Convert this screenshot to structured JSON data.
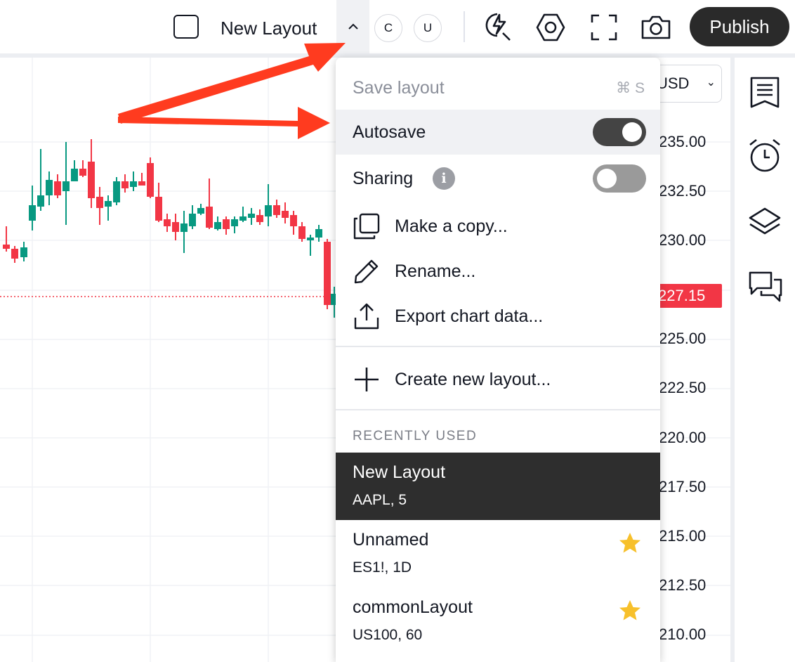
{
  "toolbar": {
    "layout_name": "New Layout",
    "c_label": "C",
    "u_label": "U",
    "publish_label": "Publish"
  },
  "price_scale": {
    "currency": "USD",
    "labels": [
      "235.00",
      "232.50",
      "230.00",
      "225.00",
      "222.50",
      "220.00",
      "217.50",
      "215.00",
      "212.50",
      "210.00"
    ],
    "current_price": "227.15"
  },
  "menu": {
    "save_layout": "Save layout",
    "save_shortcut": "⌘ S",
    "autosave": "Autosave",
    "autosave_on": true,
    "sharing": "Sharing",
    "sharing_info": "i",
    "sharing_on": false,
    "make_copy": "Make a copy...",
    "rename": "Rename...",
    "export": "Export chart data...",
    "create_new": "Create new layout...",
    "recently_used_title": "RECENTLY USED",
    "recent": [
      {
        "name": "New Layout",
        "sub": "AAPL, 5",
        "active": true,
        "starred": false
      },
      {
        "name": "Unnamed",
        "sub": "ES1!, 1D",
        "active": false,
        "starred": true
      },
      {
        "name": "commonLayout",
        "sub": "US100, 60",
        "active": false,
        "starred": true
      }
    ]
  },
  "colors": {
    "up": "#089981",
    "down": "#f23645",
    "arrow": "#ff3b1f",
    "star": "#f7c02b"
  }
}
